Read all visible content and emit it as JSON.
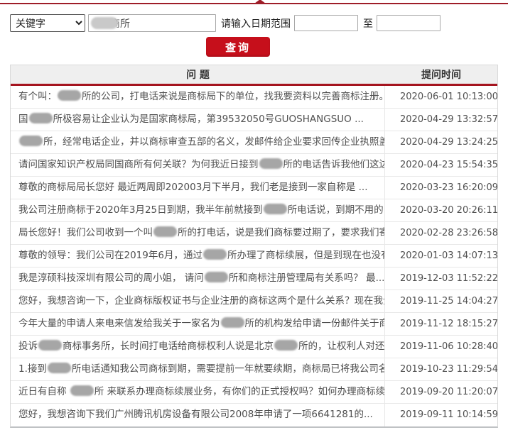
{
  "colors": {
    "top_line_red": "#9e1d28",
    "header_rule_red": "#a5141f",
    "button_red": "#c60f1b",
    "header_bg": "#efefef",
    "text_gray": "#4f4f4f"
  },
  "search_bar": {
    "keyword_select_value": "关键字",
    "keyword_input_value": "商所",
    "keyword_input_redacted": true,
    "date_label": "请输入日期范围",
    "date_from_value": "",
    "date_to_label": "至",
    "date_to_value": "",
    "submit_label": "查询"
  },
  "table": {
    "headers": {
      "question": "问 题",
      "time": "提问时间"
    },
    "rows": [
      {
        "time": "2020-06-01 10:13:00",
        "parts": [
          {
            "t": "text",
            "v": "有个叫："
          },
          {
            "t": "blur"
          },
          {
            "t": "text",
            "v": "所的公司，打电话来说是商标局下的单位，找我要资料以完善商标注册。但我..."
          }
        ]
      },
      {
        "time": "2020-04-29 13:32:57",
        "parts": [
          {
            "t": "text",
            "v": "国"
          },
          {
            "t": "blur"
          },
          {
            "t": "text",
            "v": "所极容易让企业认为是国家商标局，第39532050号GUOSHANGSUO ..."
          }
        ]
      },
      {
        "time": "2020-04-29 13:24:25",
        "parts": [
          {
            "t": "blur"
          },
          {
            "t": "text",
            "v": "所，经常电话企业，并以商标审查五部的名义，发邮件给企业要求回传企业执照盖章扫..."
          }
        ]
      },
      {
        "time": "2020-04-23 15:54:35",
        "parts": [
          {
            "t": "text",
            "v": "请问国家知识产权局同国商所有何关联？为何我近日接到"
          },
          {
            "t": "blur"
          },
          {
            "t": "text",
            "v": "所的电话告诉我他们这边是知..."
          }
        ]
      },
      {
        "time": "2020-03-23 16:20:09",
        "parts": [
          {
            "t": "text",
            "v": "尊敬的商标局局长您好 最近两周即202003月下半月，我们老是接到一家自称是 ..."
          }
        ]
      },
      {
        "time": "2020-03-20 20:26:11",
        "parts": [
          {
            "t": "text",
            "v": "我公司注册商标于2020年3月25日到期，我半年前就接到"
          },
          {
            "t": "blur"
          },
          {
            "t": "text",
            "v": "所电话说，到期不用的..."
          }
        ]
      },
      {
        "time": "2020-02-28 23:26:58",
        "parts": [
          {
            "t": "text",
            "v": "局长您好！我们公司收到一个叫"
          },
          {
            "t": "blur"
          },
          {
            "t": "text",
            "v": "所的打电话，说是我们商标要过期了，要求我们寄资料..."
          }
        ]
      },
      {
        "time": "2020-01-03 14:07:13",
        "parts": [
          {
            "t": "text",
            "v": "尊敬的领导：我们公司在2019年6月，通过"
          },
          {
            "t": "blur"
          },
          {
            "t": "text",
            "v": "所办理了商标续展，但是到现在也没有..."
          }
        ]
      },
      {
        "time": "2019-12-03 11:52:22",
        "parts": [
          {
            "t": "text",
            "v": "我是淳硕科技深圳有限公司的周小姐， 请问"
          },
          {
            "t": "blur"
          },
          {
            "t": "text",
            "v": "所和商标注册管理局有关系吗？ 最..."
          }
        ]
      },
      {
        "time": "2019-11-25 14:04:27",
        "parts": [
          {
            "t": "text",
            "v": "您好，我想咨询一下，企业商标版权证书与企业注册的商标这两个是什么关系？现在我企业..."
          }
        ]
      },
      {
        "time": "2019-11-12 18:15:27",
        "parts": [
          {
            "t": "text",
            "v": "今年大量的申请人来电来信发给我关于一家名为"
          },
          {
            "t": "blur"
          },
          {
            "t": "text",
            "v": "所的机构发给申请一份邮件关于商标续..."
          }
        ]
      },
      {
        "time": "2019-11-06 10:28:40",
        "parts": [
          {
            "t": "text",
            "v": "投诉"
          },
          {
            "t": "blur"
          },
          {
            "t": "text",
            "v": "商标事务所，长时间打电话给商标权利人说是北京"
          },
          {
            "t": "blur"
          },
          {
            "t": "text",
            "v": "所的，让权利人对还未到续..."
          }
        ]
      },
      {
        "time": "2019-10-23 11:29:54",
        "parts": [
          {
            "t": "text",
            "v": "1.接到"
          },
          {
            "t": "blur"
          },
          {
            "t": "text",
            "v": "所电话通知我公司商标到期，需要提前一年就要续期，商标局已将我公司名单..."
          }
        ]
      },
      {
        "time": "2019-09-20 11:20:07",
        "parts": [
          {
            "t": "text",
            "v": "近日有自称 "
          },
          {
            "t": "blur"
          },
          {
            "t": "text",
            "v": "所 来联系办理商标续展业务，有你们的正式授权吗？如何办理商标续展..."
          }
        ]
      },
      {
        "time": "2019-09-11 10:14:59",
        "parts": [
          {
            "t": "text",
            "v": "您好，我想咨询下我们广州腾讯机房设备有限公司2008年申请了一项6641281的..."
          }
        ]
      }
    ]
  }
}
